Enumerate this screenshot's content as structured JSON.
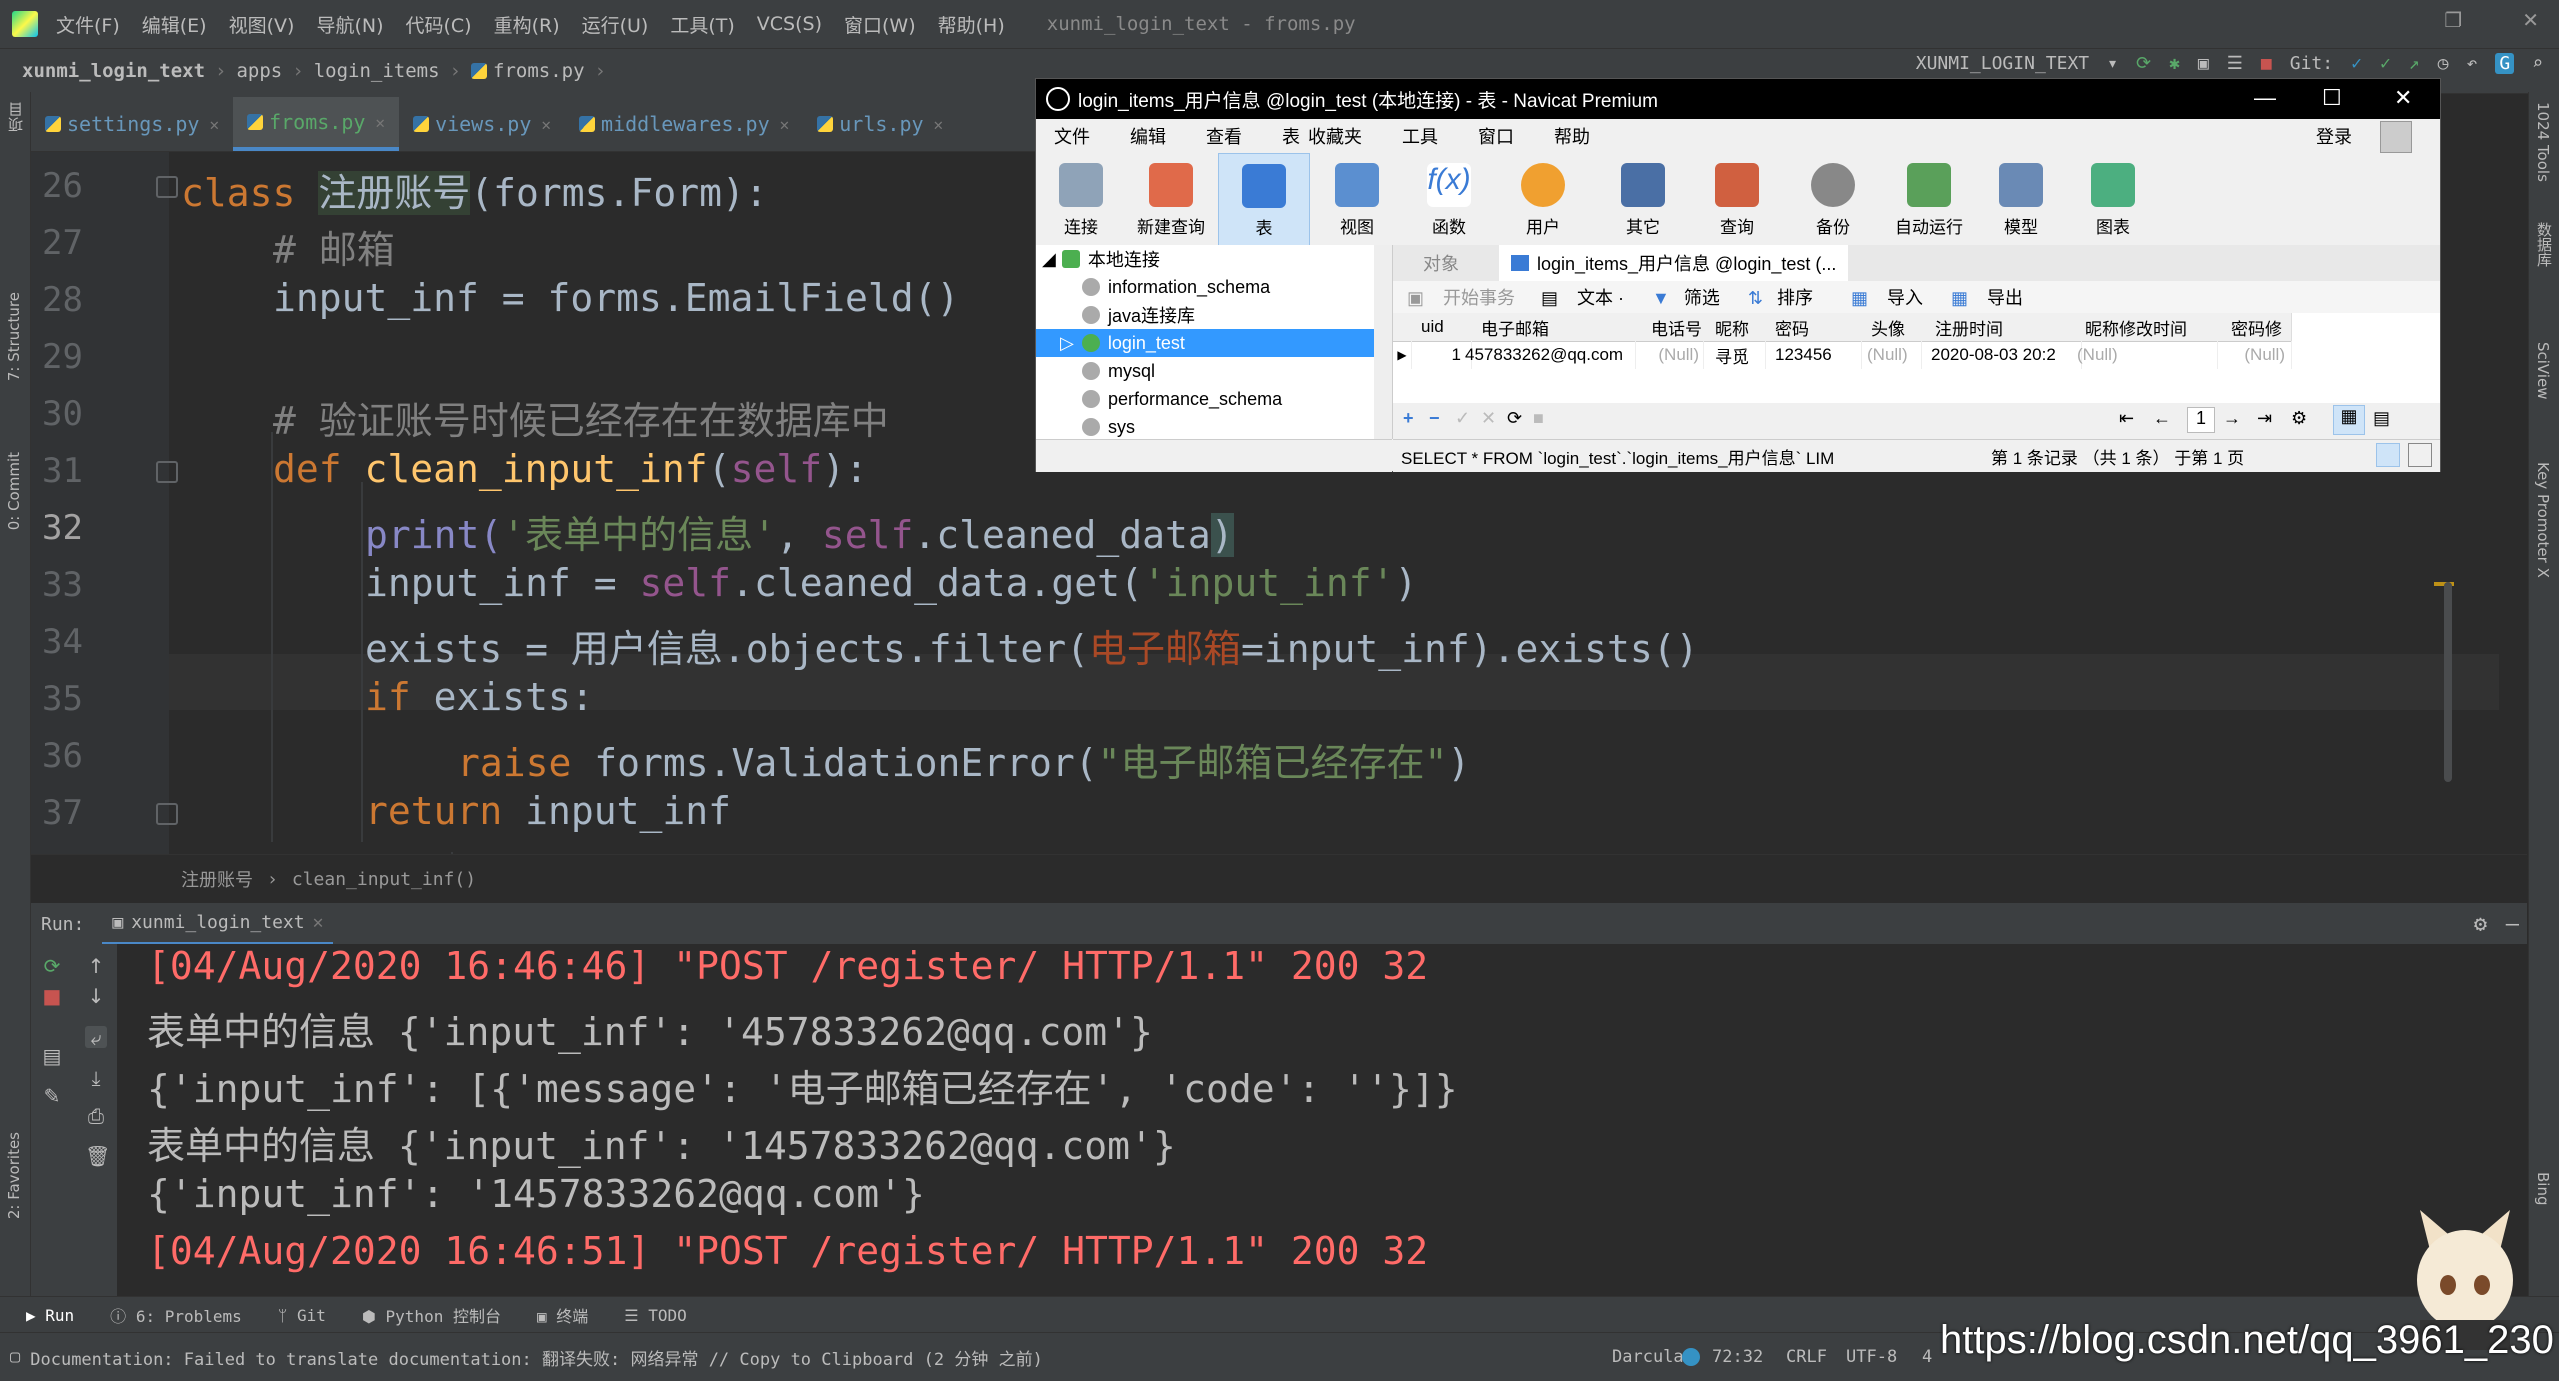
{
  "menu": [
    "文件(F)",
    "编辑(E)",
    "视图(V)",
    "导航(N)",
    "代码(C)",
    "重构(R)",
    "运行(U)",
    "工具(T)",
    "VCS(S)",
    "窗口(W)",
    "帮助(H)"
  ],
  "window_title": "xunmi_login_text - froms.py",
  "breadcrumb": [
    "xunmi_login_text",
    "apps",
    "login_items",
    "froms.py"
  ],
  "run_config": "XUNMI_LOGIN_TEXT",
  "git_label": "Git:",
  "tabs": [
    {
      "name": "settings.py",
      "active": false
    },
    {
      "name": "froms.py",
      "active": true
    },
    {
      "name": "views.py",
      "active": false
    },
    {
      "name": "middlewares.py",
      "active": false
    },
    {
      "name": "urls.py",
      "active": false
    }
  ],
  "left_strip": [
    "项目",
    "7: Structure",
    "0: Commit",
    "2: Favorites"
  ],
  "right_strip": [
    "1024 Tools",
    "数据库",
    "SciView",
    "Key Promoter X",
    "Bing"
  ],
  "code": {
    "lines": [
      "26",
      "27",
      "28",
      "29",
      "30",
      "31",
      "32",
      "33",
      "34",
      "35",
      "36",
      "37"
    ],
    "l26_kw": "class ",
    "l26_name": "注册账号",
    "l26_rest": "(forms.Form):",
    "l27": "# 邮箱",
    "l28": "input_inf = forms.EmailField()",
    "l30": "# 验证账号时候已经存在在数据库中",
    "l31_kw": "def ",
    "l31_fn": "clean_input_inf",
    "l31_p1": "(",
    "l31_self": "self",
    "l31_p2": "):",
    "l32_fn": "print(",
    "l32_str": "'表单中的信息'",
    "l32_c": ", ",
    "l32_self": "self",
    "l32_rest": ".cleaned_data",
    "l32_end": ")",
    "l33_a": "input_inf = ",
    "l33_self": "self",
    "l33_b": ".cleaned_data.get(",
    "l33_str": "'input_inf'",
    "l33_c": ")",
    "l34_a": "exists = 用户信息.objects.filter(",
    "l34_param": "电子邮箱",
    "l34_b": "=input_inf).exists()",
    "l35_kw": "if ",
    "l35_rest": "exists:",
    "l36_kw": "raise ",
    "l36_a": "forms.ValidationError(",
    "l36_str": "\"电子邮箱已经存在\"",
    "l36_b": ")",
    "l37_kw": "return ",
    "l37_rest": "input_inf"
  },
  "code_crumbs": [
    "注册账号",
    "clean_input_inf()"
  ],
  "run": {
    "label": "Run:",
    "tab": "xunmi_login_text",
    "output": [
      {
        "text": "[04/Aug/2020 16:46:46] \"POST /register/ HTTP/1.1\" 200 32",
        "kind": "red"
      },
      {
        "text": "表单中的信息 {'input_inf': '457833262@qq.com'}",
        "kind": "norm"
      },
      {
        "text": "{'input_inf': [{'message': '电子邮箱已经存在', 'code': ''}]}",
        "kind": "norm"
      },
      {
        "text": "表单中的信息 {'input_inf': '1457833262@qq.com'}",
        "kind": "norm"
      },
      {
        "text": "{'input_inf': '1457833262@qq.com'}",
        "kind": "norm"
      },
      {
        "text": "[04/Aug/2020 16:46:51] \"POST /register/ HTTP/1.1\" 200 32",
        "kind": "red"
      }
    ]
  },
  "tool_tabs": [
    "Run",
    "6: Problems",
    "Git",
    "Python 控制台",
    "终端",
    "TODO"
  ],
  "status": {
    "message": "Documentation: Failed to translate documentation: 翻译失败: 网络异常 // Copy to Clipboard (2 分钟 之前)",
    "theme": "Darcula",
    "position": "72:32",
    "line_sep": "CRLF",
    "encoding": "UTF-8",
    "indent": "4"
  },
  "navicat": {
    "title": "login_items_用户信息 @login_test (本地连接) - 表 - Navicat Premium",
    "menu": [
      "文件",
      "编辑",
      "查看",
      "表",
      "收藏夹",
      "工具",
      "窗口",
      "帮助"
    ],
    "login": "登录",
    "toolbar": [
      "连接",
      "新建查询",
      "表",
      "视图",
      "函数",
      "用户",
      "其它",
      "查询",
      "备份",
      "自动运行",
      "模型",
      "图表"
    ],
    "tree": [
      "本地连接",
      "information_schema",
      "java连接库",
      "login_test",
      "mysql",
      "performance_schema",
      "sys"
    ],
    "obj_tab": "对象",
    "table_tab": "login_items_用户信息 @login_test (...",
    "subbar": [
      "开始事务",
      "文本 ·",
      "筛选",
      "排序",
      "导入",
      "导出"
    ],
    "columns": [
      "uid",
      "电子邮箱",
      "电话号",
      "昵称",
      "密码",
      "头像",
      "注册时间",
      "昵称修改时间",
      "密码修"
    ],
    "row": [
      "1",
      "457833262@qq.com",
      "(Null)",
      "寻觅",
      "123456",
      "(Null)",
      "2020-08-03 20:2",
      "(Null)",
      "(Null)"
    ],
    "page": "1",
    "sql": "SELECT * FROM `login_test`.`login_items_用户信息` LIM",
    "record_info": "第 1 条记录 （共 1 条） 于第 1 页"
  },
  "watermark": "https://blog.csdn.net/qq_3961_230"
}
